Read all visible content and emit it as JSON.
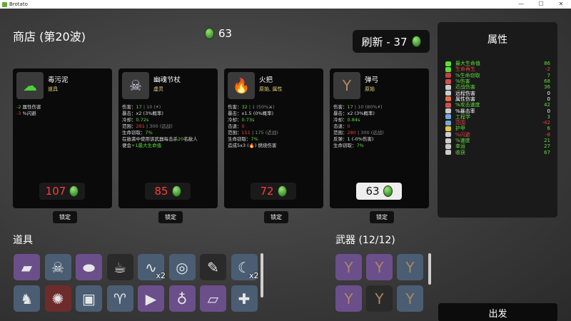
{
  "window": {
    "title": "Brotato",
    "min": "—",
    "max": "☐",
    "close": "✕"
  },
  "shop": {
    "title": "商店 (第20波)",
    "gold": "63",
    "reroll_label": "刷新 - 37"
  },
  "cards": [
    {
      "name": "毒污泥",
      "type": "道具",
      "lines": [
        [
          {
            "t": "-2",
            "c": "green"
          },
          {
            "t": " 属性伤害",
            "c": ""
          }
        ],
        [
          {
            "t": "-3",
            "c": "red"
          },
          {
            "t": " %闪避",
            "c": ""
          }
        ]
      ],
      "price": "107",
      "affordable": false,
      "lock": "锁定"
    },
    {
      "name": "幽魂节杖",
      "type": "虚灵",
      "lines": [
        [
          {
            "t": "伤害：",
            "c": ""
          },
          {
            "t": "17",
            "c": "green"
          },
          {
            "t": " | 10 (",
            "c": "grey"
          },
          {
            "t": "⚡",
            "c": ""
          },
          {
            "t": ")",
            "c": "grey"
          }
        ],
        [
          {
            "t": "暴击：x2 (3%概率)",
            "c": ""
          }
        ],
        [
          {
            "t": "冷却：",
            "c": ""
          },
          {
            "t": "0.72s",
            "c": "green"
          }
        ],
        [
          {
            "t": "范围：",
            "c": ""
          },
          {
            "t": "281",
            "c": "red"
          },
          {
            "t": " | 300 (远战)",
            "c": "grey"
          }
        ],
        [
          {
            "t": "生命窃取：",
            "c": ""
          },
          {
            "t": "7%",
            "c": "green"
          }
        ],
        [
          {
            "t": "在敌袭中使用该武器每击杀",
            "c": ""
          },
          {
            "t": "20",
            "c": "green"
          },
          {
            "t": "名敌人",
            "c": ""
          }
        ],
        [
          {
            "t": "便会",
            "c": ""
          },
          {
            "t": "+1最大生命值",
            "c": "green"
          }
        ]
      ],
      "price": "85",
      "affordable": false,
      "lock": "锁定"
    },
    {
      "name": "火把",
      "type": "原始, 属性",
      "lines": [
        [
          {
            "t": "伤害：",
            "c": ""
          },
          {
            "t": "32",
            "c": "green"
          },
          {
            "t": " | 1 (50%",
            "c": "grey"
          },
          {
            "t": "⚔",
            "c": ""
          },
          {
            "t": ")",
            "c": "grey"
          }
        ],
        [
          {
            "t": "暴击：x1.5 (0%概率)",
            "c": ""
          }
        ],
        [
          {
            "t": "冷却：",
            "c": ""
          },
          {
            "t": "0.73s",
            "c": "green"
          }
        ],
        [
          {
            "t": "击退：",
            "c": ""
          },
          {
            "t": "0",
            "c": "red"
          }
        ],
        [
          {
            "t": "范围：",
            "c": ""
          },
          {
            "t": "151",
            "c": "red"
          },
          {
            "t": " | 175 (近战)",
            "c": "grey"
          }
        ],
        [
          {
            "t": "生命窃取：",
            "c": ""
          },
          {
            "t": "7%",
            "c": "green"
          }
        ],
        [
          {
            "t": "造成5x3 (",
            "c": ""
          },
          {
            "t": "🔥",
            "c": ""
          },
          {
            "t": ") 燃烧伤害",
            "c": ""
          }
        ]
      ],
      "price": "72",
      "affordable": false,
      "lock": "锁定"
    },
    {
      "name": "弹弓",
      "type": "原始",
      "lines": [
        [
          {
            "t": "伤害：",
            "c": ""
          },
          {
            "t": "17",
            "c": "green"
          },
          {
            "t": " | 10 (80%",
            "c": "grey"
          },
          {
            "t": "⚡",
            "c": ""
          },
          {
            "t": ")",
            "c": "grey"
          }
        ],
        [
          {
            "t": "暴击：x2 (3%概率)",
            "c": ""
          }
        ],
        [
          {
            "t": "冷却：",
            "c": ""
          },
          {
            "t": "0.84s",
            "c": "green"
          }
        ],
        [
          {
            "t": "击退：",
            "c": ""
          },
          {
            "t": "0",
            "c": "red"
          }
        ],
        [
          {
            "t": "范围：",
            "c": ""
          },
          {
            "t": "280",
            "c": "red"
          },
          {
            "t": " | 300 (远战)",
            "c": "grey"
          }
        ],
        [
          {
            "t": "反弹：1 (-0%伤害)",
            "c": ""
          }
        ],
        [
          {
            "t": "生命窃取：",
            "c": ""
          },
          {
            "t": "7%",
            "c": "green"
          }
        ]
      ],
      "price": "63",
      "affordable": true,
      "lock": "锁定"
    }
  ],
  "stats_panel": {
    "title": "属性",
    "rows": [
      {
        "label": "最大生命值",
        "value": "86",
        "color": "#5fdc3a",
        "icon": "heart-icon",
        "icolor": "#5fdc3a"
      },
      {
        "label": "生命再生",
        "value": "-2",
        "color": "#e84040",
        "icon": "regen-icon",
        "icolor": "#5fdc3a"
      },
      {
        "label": "%生命窃取",
        "value": "7",
        "color": "#5fdc3a",
        "icon": "lifesteal-icon",
        "icolor": "#c04040"
      },
      {
        "label": "%伤害",
        "value": "68",
        "color": "#5fdc3a",
        "icon": "damage-icon",
        "icolor": "#d05050"
      },
      {
        "label": "近战伤害",
        "value": "36",
        "color": "#5fdc3a",
        "icon": "melee-icon",
        "icolor": "#cccccc"
      },
      {
        "label": "远程伤害",
        "value": "0",
        "color": "#ffffff",
        "icon": "ranged-icon",
        "icolor": "#cccccc"
      },
      {
        "label": "属性伤害",
        "value": "0",
        "color": "#ffffff",
        "icon": "elemental-icon",
        "icolor": "#e0704a"
      },
      {
        "label": "%攻击速度",
        "value": "42",
        "color": "#5fdc3a",
        "icon": "attack-speed-icon",
        "icolor": "#d05050"
      },
      {
        "label": "%暴击率",
        "value": "0",
        "color": "#ffffff",
        "icon": "crit-icon",
        "icolor": "#cccccc"
      },
      {
        "label": "工程学",
        "value": "3",
        "color": "#5fdc3a",
        "icon": "engineering-icon",
        "icolor": "#7aa6d8"
      },
      {
        "label": "范围",
        "value": "-42",
        "color": "#e84040",
        "icon": "range-icon",
        "icolor": "#7aa6d8"
      },
      {
        "label": "护甲",
        "value": "6",
        "color": "#5fdc3a",
        "icon": "armor-icon",
        "icolor": "#e8c440"
      },
      {
        "label": "%闪避",
        "value": "-8",
        "color": "#e84040",
        "icon": "dodge-icon",
        "icolor": "#cccccc"
      },
      {
        "label": "%速度",
        "value": "21",
        "color": "#5fdc3a",
        "icon": "speed-icon",
        "icolor": "#cccccc"
      },
      {
        "label": "幸运",
        "value": "27",
        "color": "#5fdc3a",
        "icon": "luck-icon",
        "icolor": "#cccccc"
      },
      {
        "label": "收获",
        "value": "67",
        "color": "#5fdc3a",
        "icon": "harvest-icon",
        "icolor": "#cccccc"
      }
    ]
  },
  "items_section": {
    "title": "道具",
    "items": [
      {
        "name": "eraser-icon",
        "glyph": "▰",
        "tier": "purple",
        "count": ""
      },
      {
        "name": "pirate-skull-icon",
        "glyph": "☠",
        "tier": "blue",
        "count": ""
      },
      {
        "name": "cannon-icon",
        "glyph": "⬬",
        "tier": "purple",
        "count": ""
      },
      {
        "name": "coffee-cup-icon",
        "glyph": "☕",
        "tier": "dark",
        "count": ""
      },
      {
        "name": "worm-icon",
        "glyph": "∿",
        "tier": "blue",
        "count": "x2"
      },
      {
        "name": "belt-icon",
        "glyph": "◎",
        "tier": "blue",
        "count": ""
      },
      {
        "name": "syringe-icon",
        "glyph": "✎",
        "tier": "dark",
        "count": ""
      },
      {
        "name": "claw-icon",
        "glyph": "☾",
        "tier": "blue",
        "count": "x2"
      },
      {
        "name": "duck-icon",
        "glyph": "♞",
        "tier": "blue",
        "count": ""
      },
      {
        "name": "spider-icon",
        "glyph": "✺",
        "tier": "red",
        "count": ""
      },
      {
        "name": "robot-icon",
        "glyph": "▣",
        "tier": "blue",
        "count": ""
      },
      {
        "name": "horns-icon",
        "glyph": "♈",
        "tier": "blue",
        "count": ""
      },
      {
        "name": "prism-icon",
        "glyph": "▶",
        "tier": "purple",
        "count": ""
      },
      {
        "name": "bag-icon",
        "glyph": "♁",
        "tier": "purple",
        "count": ""
      },
      {
        "name": "bandage-icon",
        "glyph": "▱",
        "tier": "purple",
        "count": ""
      },
      {
        "name": "medkit-icon",
        "glyph": "✚",
        "tier": "blue",
        "count": ""
      }
    ]
  },
  "weapons_section": {
    "title": "武器 (12/12)",
    "weapons": [
      {
        "name": "slingshot-icon",
        "glyph": "Y",
        "tier": "purple"
      },
      {
        "name": "slingshot-icon",
        "glyph": "Y",
        "tier": "purple"
      },
      {
        "name": "slingshot-icon",
        "glyph": "Y",
        "tier": "blue"
      },
      {
        "name": "slingshot-icon",
        "glyph": "Y",
        "tier": "purple"
      },
      {
        "name": "slingshot-icon",
        "glyph": "Y",
        "tier": "dark"
      },
      {
        "name": "slingshot-icon",
        "glyph": "Y",
        "tier": "blue"
      }
    ]
  },
  "go_button": "出发"
}
